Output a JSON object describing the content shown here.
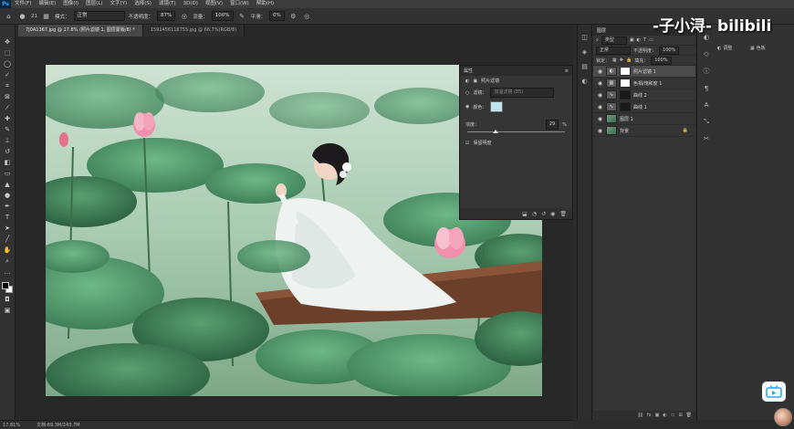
{
  "menubar": {
    "logo": "Ps",
    "items": [
      "文件(F)",
      "编辑(E)",
      "图像(I)",
      "图层(L)",
      "文字(Y)",
      "选择(S)",
      "滤镜(T)",
      "3D(D)",
      "视图(V)",
      "窗口(W)",
      "帮助(H)"
    ]
  },
  "options": {
    "size": "21",
    "mode_label": "模式：",
    "mode_value": "正常",
    "opacity_label": "不透明度：",
    "opacity_value": "87%",
    "flow_label": "流量：",
    "flow_value": "100%",
    "smooth_label": "平滑：",
    "smooth_value": "0%"
  },
  "tabs": [
    {
      "label": "7J0A1367.jpg @ 17.8% (照片滤镜 1, 图层蒙版/8) *",
      "active": true
    },
    {
      "label": "1591456116755.jpg @ 66.7%(RGB/8)",
      "active": false
    }
  ],
  "status": {
    "zoom": "17.81%",
    "doc": "文档:69.3M/243.7M"
  },
  "properties": {
    "title": "属性",
    "layer_type": "照片滤镜",
    "filter_label": "滤镜：",
    "filter_value": "加温滤镜 (85)",
    "color_label": "颜色：",
    "color_hex": "#bfe3ef",
    "density_label": "浓度：",
    "density_value": "29",
    "density_unit": "%",
    "density": 0.29,
    "preserve_label": "保留明度"
  },
  "layers": {
    "tab": "图层",
    "kind_label": "类型",
    "blend": "正常",
    "opacity_label": "不透明度：",
    "opacity_value": "100%",
    "lock_label": "锁定：",
    "fill_label": "填充：",
    "fill_value": "100%",
    "items": [
      {
        "name": "照片滤镜 1",
        "selected": true
      },
      {
        "name": "色相/饱和度 1",
        "selected": false
      },
      {
        "name": "曲线 2",
        "selected": false
      },
      {
        "name": "曲线 1",
        "selected": false
      },
      {
        "name": "图层 1",
        "selected": false
      },
      {
        "name": "背景",
        "selected": false
      }
    ]
  },
  "right_dock": {
    "adjust_label": "调整",
    "colors_label": "色板"
  },
  "watermark": "-子小浔- bilibili"
}
